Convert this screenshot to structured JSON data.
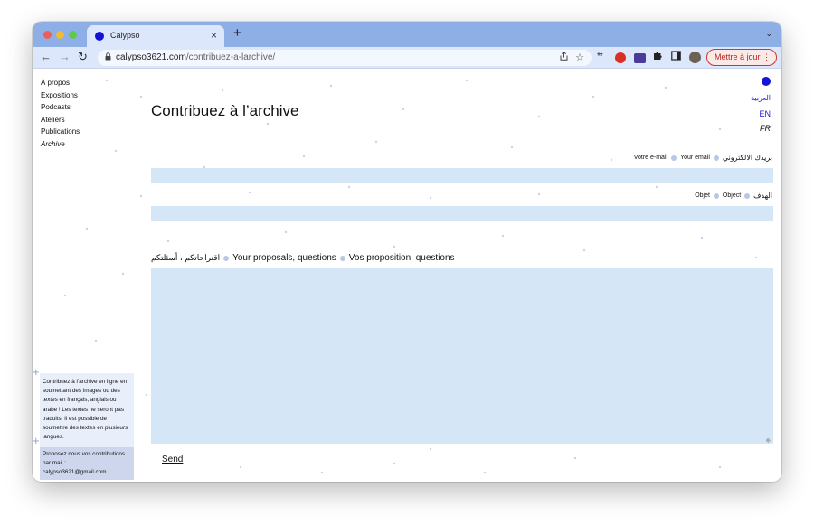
{
  "browser": {
    "tab_title": "Calypso",
    "tab_close": "×",
    "new_tab": "+",
    "tab_menu": "⌄",
    "url_domain": "calypso3621.com",
    "url_path": "/contribuez-a-larchive/",
    "update_label": "Mettre à jour",
    "update_menu": "⋮",
    "icons": [
      "back-arrow-icon",
      "forward-arrow-icon",
      "reload-icon",
      "lock-icon",
      "share-icon",
      "star-icon",
      "password-extension-icon",
      "red-extension-icon",
      "mail-extension-icon",
      "puzzle-icon",
      "side-panel-icon",
      "profile-avatar-icon"
    ],
    "colors": {
      "tabstrip": "#8eaee6",
      "toolbar": "#dce7fb",
      "update": "#c9392b"
    }
  },
  "nav": {
    "items": [
      {
        "label": "À propos"
      },
      {
        "label": "Expositions"
      },
      {
        "label": "Podcasts"
      },
      {
        "label": "Ateliers"
      },
      {
        "label": "Publications"
      },
      {
        "label": "Archive"
      }
    ]
  },
  "page": {
    "title": "Contribuez à l’archive",
    "languages": {
      "ar": "العربية",
      "en": "EN",
      "fr": "FR"
    },
    "email": {
      "label_fr": "Votre e-mail",
      "label_en": "Your email",
      "label_ar": "بريدك الالكتروني",
      "value": ""
    },
    "object": {
      "label_fr": "Objet",
      "label_en": "Object",
      "label_ar": "الهدف",
      "value": ""
    },
    "message": {
      "label_ar": "اقتراحاتكم ، أسئلتكم",
      "label_en": "Your proposals, questions",
      "label_fr": "Vos proposition, questions",
      "value": ""
    },
    "send_label": "Send",
    "info_text": "Contribuez à l’archive en ligne en soumettant des images ou des textes en français, anglais ou arabe ! Les textes ne seront pas traduits. Il est possible de soumettre des textes en plusieurs langues.",
    "contact_text": "Proposez nous vos contributions par mail : calypso3621@gmail.com",
    "colors": {
      "field_bg": "#d5e6f6",
      "accent_blue": "#1414d8",
      "dot": "#c9d2f4"
    }
  }
}
